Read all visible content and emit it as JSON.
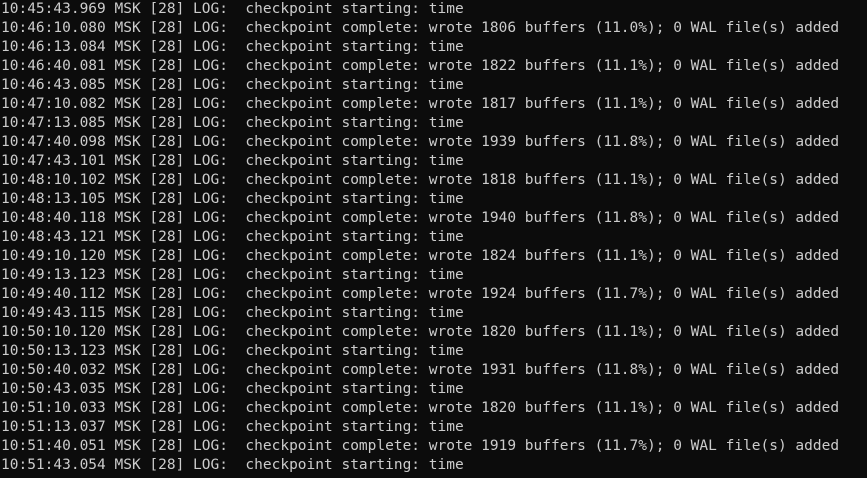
{
  "terminal": {
    "lines": [
      "10:45:43.969 MSK [28] LOG:  checkpoint starting: time",
      "10:46:10.080 MSK [28] LOG:  checkpoint complete: wrote 1806 buffers (11.0%); 0 WAL file(s) added",
      "10:46:13.084 MSK [28] LOG:  checkpoint starting: time",
      "10:46:40.081 MSK [28] LOG:  checkpoint complete: wrote 1822 buffers (11.1%); 0 WAL file(s) added",
      "10:46:43.085 MSK [28] LOG:  checkpoint starting: time",
      "10:47:10.082 MSK [28] LOG:  checkpoint complete: wrote 1817 buffers (11.1%); 0 WAL file(s) added",
      "10:47:13.085 MSK [28] LOG:  checkpoint starting: time",
      "10:47:40.098 MSK [28] LOG:  checkpoint complete: wrote 1939 buffers (11.8%); 0 WAL file(s) added",
      "10:47:43.101 MSK [28] LOG:  checkpoint starting: time",
      "10:48:10.102 MSK [28] LOG:  checkpoint complete: wrote 1818 buffers (11.1%); 0 WAL file(s) added",
      "10:48:13.105 MSK [28] LOG:  checkpoint starting: time",
      "10:48:40.118 MSK [28] LOG:  checkpoint complete: wrote 1940 buffers (11.8%); 0 WAL file(s) added",
      "10:48:43.121 MSK [28] LOG:  checkpoint starting: time",
      "10:49:10.120 MSK [28] LOG:  checkpoint complete: wrote 1824 buffers (11.1%); 0 WAL file(s) added",
      "10:49:13.123 MSK [28] LOG:  checkpoint starting: time",
      "10:49:40.112 MSK [28] LOG:  checkpoint complete: wrote 1924 buffers (11.7%); 0 WAL file(s) added",
      "10:49:43.115 MSK [28] LOG:  checkpoint starting: time",
      "10:50:10.120 MSK [28] LOG:  checkpoint complete: wrote 1820 buffers (11.1%); 0 WAL file(s) added",
      "10:50:13.123 MSK [28] LOG:  checkpoint starting: time",
      "10:50:40.032 MSK [28] LOG:  checkpoint complete: wrote 1931 buffers (11.8%); 0 WAL file(s) added",
      "10:50:43.035 MSK [28] LOG:  checkpoint starting: time",
      "10:51:10.033 MSK [28] LOG:  checkpoint complete: wrote 1820 buffers (11.1%); 0 WAL file(s) added",
      "10:51:13.037 MSK [28] LOG:  checkpoint starting: time",
      "10:51:40.051 MSK [28] LOG:  checkpoint complete: wrote 1919 buffers (11.7%); 0 WAL file(s) added",
      "10:51:43.054 MSK [28] LOG:  checkpoint starting: time"
    ]
  },
  "colors": {
    "background": "#0c0c0c",
    "text": "#cccccc"
  }
}
